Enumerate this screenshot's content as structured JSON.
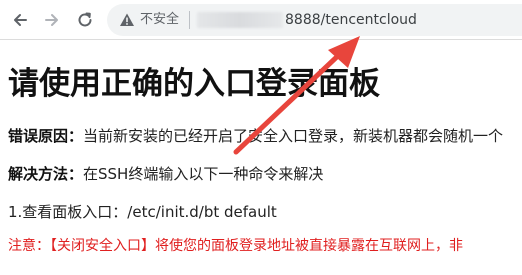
{
  "browser": {
    "security_label": "不安全",
    "url_visible": "8888/tencentcloud",
    "icons": {
      "back": "arrow-left-icon",
      "forward": "arrow-right-icon",
      "reload": "reload-icon",
      "security": "warning-triangle-icon"
    }
  },
  "page": {
    "title": "请使用正确的入口登录面板",
    "error_label": "错误原因：",
    "error_text": "当前新安装的已经开启了安全入口登录，新装机器都会随机一个",
    "solution_label": "解决方法：",
    "solution_text": "在SSH终端输入以下一种命令来解决",
    "step_text": "1.查看面板入口：/etc/init.d/bt default",
    "warning_text": "注意：【关闭安全入口】将使您的面板登录地址被直接暴露在互联网上，非"
  },
  "colors": {
    "accent_red": "#e02020",
    "annotation_arrow": "#e8453c",
    "omnibox_bg": "#f1f3f4"
  }
}
